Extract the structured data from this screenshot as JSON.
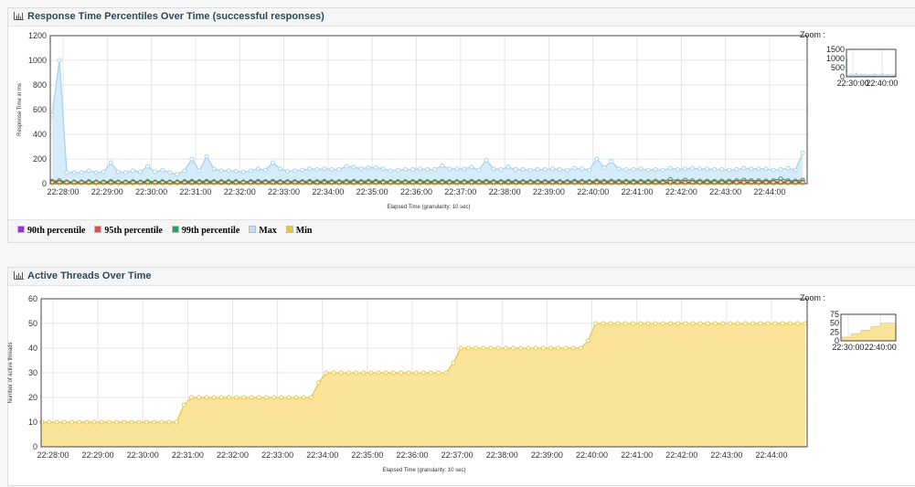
{
  "panels": [
    {
      "title": "Response Time Percentiles Over Time (successful responses)",
      "zoom_label": "Zoom :",
      "legend": [
        {
          "label": "90th percentile",
          "color": "#9b30d9"
        },
        {
          "label": "95th percentile",
          "color": "#d9534f"
        },
        {
          "label": "99th percentile",
          "color": "#2ca25f"
        },
        {
          "label": "Max",
          "color": "#bfe0f5"
        },
        {
          "label": "Min",
          "color": "#f0c330"
        }
      ]
    },
    {
      "title": "Active Threads Over Time",
      "zoom_label": "Zoom :"
    }
  ],
  "chart_data": [
    {
      "type": "line",
      "title": "Response Time Percentiles Over Time (successful responses)",
      "xlabel": "Elapsed Time (granularity: 10 sec)",
      "ylabel": "Response Time in ms",
      "ylim": [
        0,
        1200
      ],
      "yticks": [
        "0",
        "200",
        "400",
        "600",
        "800",
        "1000",
        "1200"
      ],
      "xticks": [
        "22:28:00",
        "22:29:00",
        "22:30:00",
        "22:31:00",
        "22:32:00",
        "22:33:00",
        "22:34:00",
        "22:35:00",
        "22:36:00",
        "22:37:00",
        "22:38:00",
        "22:39:00",
        "22:40:00",
        "22:41:00",
        "22:42:00",
        "22:43:00",
        "22:44:00"
      ],
      "x_start": "22:27:45",
      "x_step_seconds": 10,
      "grid": true,
      "legend_placement": "bottom",
      "zoom_yticks": [
        "0",
        "500",
        "1000",
        "1500"
      ],
      "zoom_xticks": [
        "22:30:00",
        "22:40:00"
      ],
      "series": [
        {
          "name": "Max",
          "color": "#a9d3ee",
          "fill": "#d7ecfa",
          "values": [
            555,
            1000,
            90,
            90,
            90,
            105,
            90,
            95,
            170,
            95,
            90,
            105,
            95,
            140,
            95,
            110,
            90,
            75,
            105,
            200,
            105,
            220,
            120,
            105,
            105,
            100,
            95,
            105,
            120,
            110,
            170,
            120,
            100,
            105,
            110,
            120,
            115,
            120,
            115,
            115,
            140,
            135,
            120,
            130,
            130,
            120,
            105,
            110,
            115,
            115,
            120,
            115,
            115,
            145,
            120,
            120,
            120,
            135,
            110,
            190,
            120,
            115,
            135,
            115,
            115,
            110,
            115,
            115,
            120,
            115,
            110,
            125,
            120,
            110,
            200,
            130,
            180,
            120,
            115,
            115,
            120,
            110,
            115,
            110,
            125,
            115,
            120,
            125,
            120,
            120,
            115,
            115,
            110,
            115,
            125,
            120,
            120,
            120,
            110,
            115,
            125,
            110,
            250
          ]
        },
        {
          "name": "99th percentile",
          "color": "#2ca25f",
          "values": [
            20,
            25,
            15,
            15,
            15,
            18,
            15,
            15,
            20,
            15,
            15,
            18,
            15,
            20,
            15,
            18,
            15,
            15,
            18,
            20,
            18,
            20,
            18,
            18,
            18,
            18,
            15,
            18,
            20,
            18,
            20,
            18,
            18,
            18,
            18,
            20,
            18,
            20,
            18,
            18,
            20,
            20,
            18,
            20,
            20,
            18,
            18,
            18,
            18,
            18,
            20,
            18,
            18,
            20,
            18,
            18,
            18,
            20,
            18,
            20,
            18,
            18,
            20,
            18,
            18,
            18,
            18,
            18,
            20,
            18,
            18,
            20,
            20,
            18,
            22,
            20,
            22,
            20,
            20,
            20,
            20,
            20,
            22,
            20,
            35,
            22,
            30,
            25,
            22,
            22,
            20,
            22,
            22,
            25,
            30,
            25,
            25,
            22,
            25,
            40,
            25,
            22,
            30
          ]
        },
        {
          "name": "95th percentile",
          "color": "#d9534f",
          "values": [
            12,
            14,
            10,
            10,
            10,
            11,
            10,
            10,
            12,
            10,
            10,
            11,
            10,
            12,
            10,
            11,
            10,
            10,
            11,
            12,
            11,
            12,
            11,
            11,
            11,
            11,
            10,
            11,
            12,
            11,
            12,
            11,
            11,
            11,
            11,
            12,
            11,
            12,
            11,
            11,
            12,
            12,
            11,
            12,
            12,
            11,
            11,
            11,
            11,
            11,
            12,
            11,
            11,
            12,
            11,
            11,
            11,
            12,
            11,
            12,
            11,
            11,
            12,
            11,
            11,
            11,
            11,
            11,
            12,
            11,
            11,
            12,
            12,
            11,
            13,
            12,
            13,
            12,
            12,
            12,
            12,
            12,
            13,
            12,
            15,
            13,
            14,
            13,
            13,
            13,
            12,
            13,
            13,
            14,
            15,
            14,
            14,
            13,
            14,
            16,
            14,
            13,
            15
          ]
        },
        {
          "name": "90th percentile",
          "color": "#9b30d9",
          "values": [
            9,
            10,
            8,
            8,
            8,
            8,
            8,
            8,
            9,
            8,
            8,
            8,
            8,
            9,
            8,
            8,
            8,
            8,
            8,
            9,
            8,
            9,
            8,
            8,
            8,
            8,
            8,
            8,
            9,
            8,
            9,
            8,
            8,
            8,
            8,
            9,
            8,
            9,
            8,
            8,
            9,
            9,
            8,
            9,
            9,
            8,
            8,
            8,
            8,
            8,
            9,
            8,
            8,
            9,
            8,
            8,
            8,
            9,
            8,
            9,
            8,
            8,
            9,
            8,
            8,
            8,
            8,
            8,
            9,
            8,
            8,
            9,
            9,
            8,
            10,
            9,
            10,
            9,
            9,
            9,
            9,
            9,
            10,
            9,
            11,
            10,
            10,
            10,
            10,
            10,
            9,
            10,
            10,
            10,
            11,
            10,
            10,
            10,
            10,
            12,
            10,
            10,
            11
          ]
        },
        {
          "name": "Min",
          "color": "#f0c330",
          "values": [
            3,
            3,
            3,
            3,
            3,
            3,
            3,
            3,
            3,
            3,
            3,
            3,
            3,
            3,
            3,
            3,
            3,
            3,
            3,
            3,
            3,
            3,
            3,
            3,
            3,
            3,
            3,
            3,
            3,
            3,
            3,
            3,
            3,
            3,
            3,
            3,
            3,
            3,
            3,
            3,
            3,
            3,
            3,
            3,
            3,
            3,
            3,
            3,
            3,
            3,
            3,
            3,
            3,
            3,
            3,
            3,
            3,
            3,
            3,
            3,
            3,
            3,
            3,
            3,
            3,
            3,
            3,
            3,
            3,
            3,
            3,
            3,
            3,
            3,
            3,
            3,
            3,
            3,
            3,
            3,
            3,
            3,
            3,
            3,
            3,
            3,
            3,
            3,
            3,
            3,
            3,
            3,
            3,
            3,
            3,
            3,
            3,
            3,
            3,
            3,
            3,
            3,
            3
          ]
        }
      ]
    },
    {
      "type": "area",
      "title": "Active Threads Over Time",
      "xlabel": "Elapsed Time (granularity: 10 sec)",
      "ylabel": "Number of active threads",
      "ylim": [
        0,
        60
      ],
      "yticks": [
        "0",
        "10",
        "20",
        "30",
        "40",
        "50",
        "60"
      ],
      "xticks": [
        "22:28:00",
        "22:29:00",
        "22:30:00",
        "22:31:00",
        "22:32:00",
        "22:33:00",
        "22:34:00",
        "22:35:00",
        "22:36:00",
        "22:37:00",
        "22:38:00",
        "22:39:00",
        "22:40:00",
        "22:41:00",
        "22:42:00",
        "22:43:00",
        "22:44:00"
      ],
      "x_start": "22:27:45",
      "x_step_seconds": 10,
      "grid": true,
      "zoom_yticks": [
        "0",
        "25",
        "50",
        "75"
      ],
      "zoom_xticks": [
        "22:30:00",
        "22:40:00"
      ],
      "series": [
        {
          "color": "#e8c84a",
          "fill": "#fbe49a",
          "values": [
            10,
            10,
            10,
            10,
            10,
            10,
            10,
            10,
            10,
            10,
            10,
            10,
            10,
            10,
            10,
            10,
            10,
            10,
            10,
            17,
            20,
            20,
            20,
            20,
            20,
            20,
            20,
            20,
            20,
            20,
            20,
            20,
            20,
            20,
            20,
            20,
            20,
            26,
            30,
            30,
            30,
            30,
            30,
            30,
            30,
            30,
            30,
            30,
            30,
            30,
            30,
            30,
            30,
            30,
            30,
            34,
            40,
            40,
            40,
            40,
            40,
            40,
            40,
            40,
            40,
            40,
            40,
            40,
            40,
            40,
            40,
            40,
            40,
            43,
            50,
            50,
            50,
            50,
            50,
            50,
            50,
            50,
            50,
            50,
            50,
            50,
            50,
            50,
            50,
            50,
            50,
            50,
            50,
            50,
            50,
            50,
            50,
            50,
            50,
            50,
            50,
            50,
            50
          ]
        }
      ]
    }
  ]
}
